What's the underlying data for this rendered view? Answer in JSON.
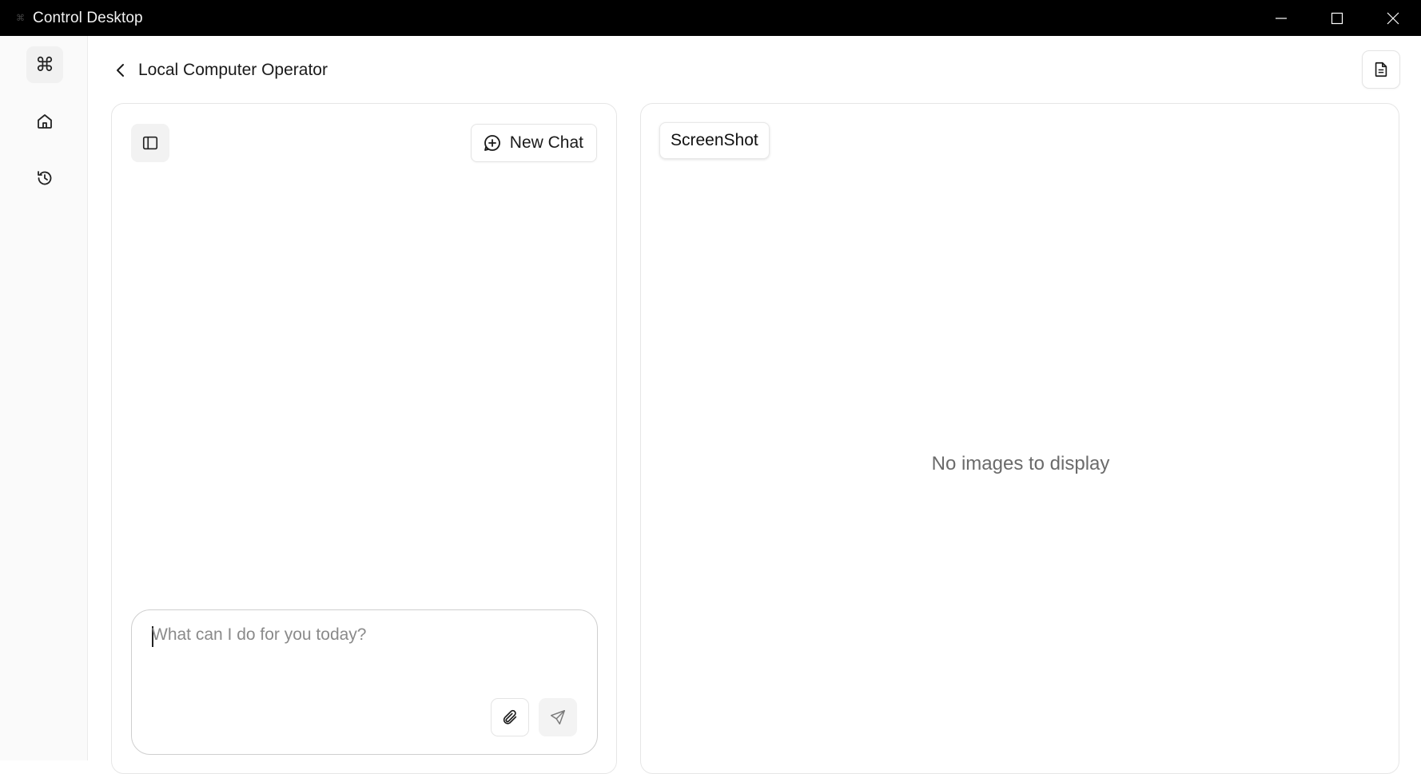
{
  "window": {
    "title": "Control Desktop"
  },
  "rail": {
    "items": [
      {
        "name": "logo",
        "icon": "command-icon"
      },
      {
        "name": "home",
        "icon": "home-icon"
      },
      {
        "name": "history",
        "icon": "history-icon"
      }
    ]
  },
  "header": {
    "title": "Local Computer Operator"
  },
  "chat": {
    "new_chat_label": "New Chat",
    "input_placeholder": "What can I do for you today?"
  },
  "screenshot": {
    "tab_label": "ScreenShot",
    "empty_message": "No images to display"
  },
  "colors": {
    "titlebar_bg": "#000000",
    "rail_bg": "#fafafa",
    "panel_border": "#e6e6e6",
    "placeholder_text": "#8a8a8a",
    "empty_text": "#6b6b6b"
  }
}
